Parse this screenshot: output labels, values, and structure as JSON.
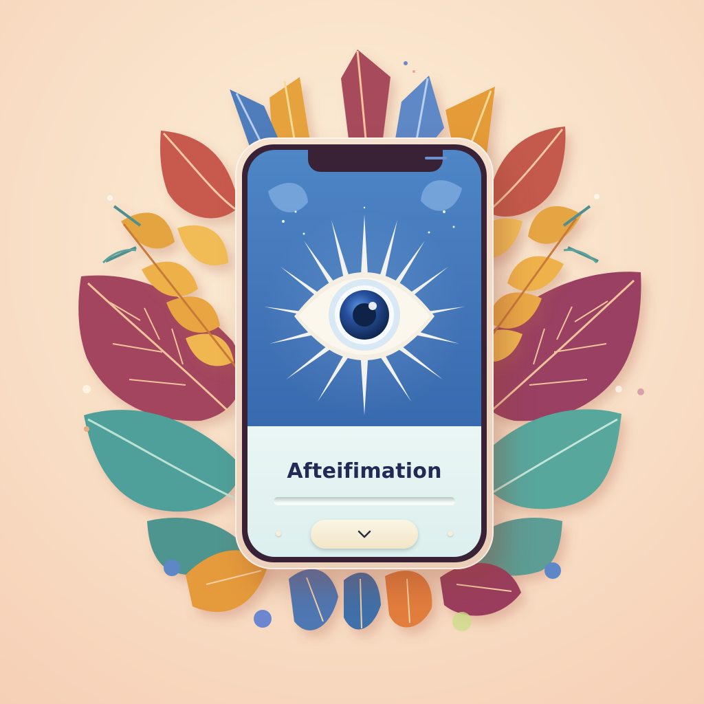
{
  "app": {
    "card_title": "Afteifimation"
  },
  "icons": {
    "center": "eye-icon",
    "button": "chevron-down-icon"
  },
  "colors": {
    "background": "#f8dfc6",
    "screen_blue": "#3f72b6",
    "card_panel": "#e3f3f1",
    "title_text": "#232a55",
    "button": "#f7eed7"
  }
}
